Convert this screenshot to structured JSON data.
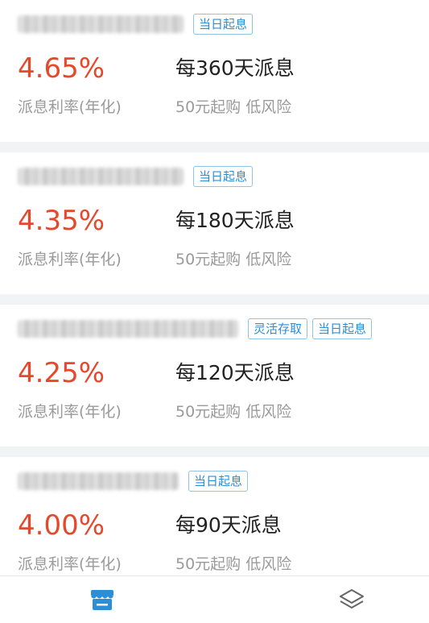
{
  "colors": {
    "rate": "#e5482b",
    "tag_border": "#8fc3e8",
    "tag_text": "#2d8ed6",
    "tab_active": "#2d8ed6",
    "tab_inactive": "#666666"
  },
  "products": [
    {
      "tags": [
        "当日起息"
      ],
      "rate": "4.65%",
      "rate_label": "派息利率(年化)",
      "period": "每360天派息",
      "min_amount": "50元起购",
      "risk": "低风险"
    },
    {
      "tags": [
        "当日起息"
      ],
      "rate": "4.35%",
      "rate_label": "派息利率(年化)",
      "period": "每180天派息",
      "min_amount": "50元起购",
      "risk": "低风险"
    },
    {
      "tags": [
        "灵活存取",
        "当日起息"
      ],
      "rate": "4.25%",
      "rate_label": "派息利率(年化)",
      "period": "每120天派息",
      "min_amount": "50元起购",
      "risk": "低风险"
    },
    {
      "tags": [
        "当日起息"
      ],
      "rate": "4.00%",
      "rate_label": "派息利率(年化)",
      "period": "每90天派息",
      "min_amount": "50元起购",
      "risk": "低风险"
    }
  ],
  "tabbar": {
    "items": [
      {
        "icon": "store-icon",
        "active": true
      },
      {
        "icon": "layers-icon",
        "active": false
      }
    ]
  }
}
